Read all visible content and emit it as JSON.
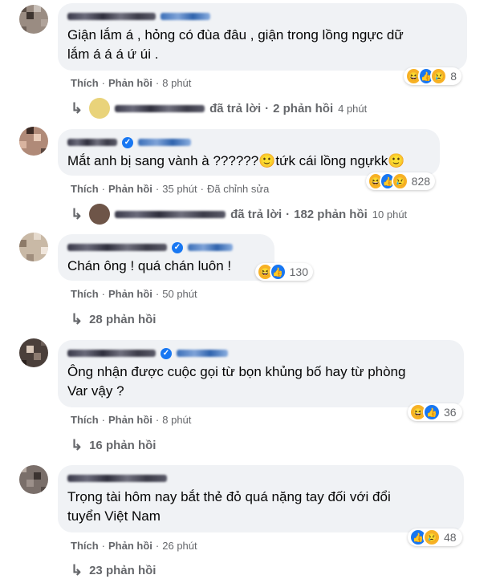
{
  "colors": {
    "bubble": "#f0f2f5",
    "meta_text": "#65676b",
    "body_text": "#050505",
    "like_blue": "#1877f2",
    "haha_yellow": "#f7b125"
  },
  "actions": {
    "like_label": "Thích",
    "reply_label": "Phản hồi",
    "edited_label": "Đã chỉnh sửa",
    "replied_label": "đã trả lời"
  },
  "comments": [
    {
      "text_line1": "Giận lắm á , hỏng có đùa đâu , giận trong lồng ngực dữ",
      "text_line2": "lắm á á á ứ úi .",
      "time": "8 phút",
      "reactions": [
        "haha-icon",
        "like-icon",
        "sad-icon"
      ],
      "reaction_count": "8",
      "reply_summary": "2 phản hồi",
      "reply_time": "4 phút"
    },
    {
      "text": "Mắt anh bị sang vành à ??????🙂tứk cái lồng ngựkk🙂",
      "time": "35 phút",
      "reactions": [
        "haha-icon",
        "like-icon",
        "sad-icon"
      ],
      "reaction_count": "828",
      "reply_summary": "182 phản hồi",
      "reply_time": "10 phút"
    },
    {
      "text": "Chán ông ! quá chán luôn !",
      "time": "50 phút",
      "reactions": [
        "haha-icon",
        "like-icon"
      ],
      "reaction_count": "130",
      "reply_summary": "28 phản hồi"
    },
    {
      "text_line1": "Ông nhận được cuộc gọi từ bọn khủng bố hay từ phòng",
      "text_line2": "Var vậy ?",
      "time": "8 phút",
      "reactions": [
        "haha-icon",
        "like-icon"
      ],
      "reaction_count": "36",
      "reply_summary": "16 phản hồi"
    },
    {
      "text_line1": "Trọng tài hôm nay bắt thẻ đỏ quá nặng tay đối với đổi",
      "text_line2": "tuyển Việt Nam",
      "time": "26 phút",
      "reactions": [
        "like-icon",
        "sad-icon"
      ],
      "reaction_count": "48",
      "reply_summary": "23 phản hồi"
    }
  ]
}
